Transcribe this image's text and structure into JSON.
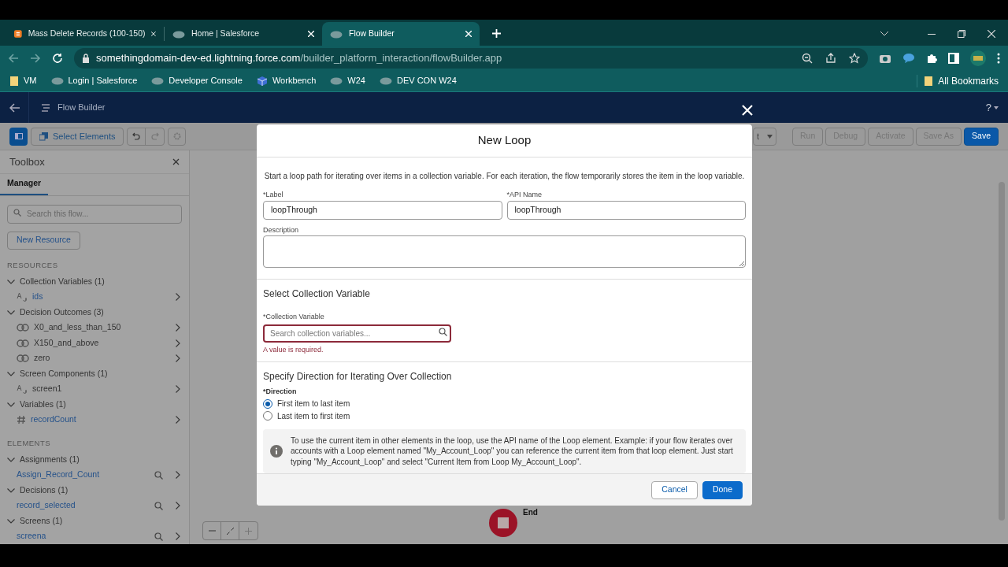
{
  "browser": {
    "tabs": [
      {
        "title": "Mass Delete Records (100-150)",
        "selected": false
      },
      {
        "title": "Home | Salesforce",
        "selected": false
      },
      {
        "title": "Flow Builder",
        "selected": true
      }
    ],
    "url_host": "somethingdomain-dev-ed.lightning.force.com",
    "url_path": "/builder_platform_interaction/flowBuilder.app",
    "bookmarks": [
      {
        "label": "VM"
      },
      {
        "label": "Login | Salesforce"
      },
      {
        "label": "Developer Console"
      },
      {
        "label": "Workbench"
      },
      {
        "label": "W24"
      },
      {
        "label": "DEV CON W24"
      }
    ],
    "all_bookmarks": "All Bookmarks"
  },
  "app_header": {
    "title": "Flow Builder",
    "help": "?"
  },
  "toolbar": {
    "select_elements": "Select Elements",
    "dropdown_visible_text": "t",
    "buttons": [
      {
        "label": "Run",
        "disabled": true
      },
      {
        "label": "Debug",
        "disabled": true
      },
      {
        "label": "Activate",
        "disabled": true
      },
      {
        "label": "Save As",
        "disabled": true
      },
      {
        "label": "Save",
        "disabled": false
      }
    ]
  },
  "toolbox": {
    "title": "Toolbox",
    "tabs": [
      {
        "label": "Manager",
        "selected": true
      }
    ],
    "search_placeholder": "Search this flow...",
    "new_resource": "New Resource",
    "sections": [
      {
        "heading": "RESOURCES",
        "groups": [
          {
            "label": "Collection Variables (1)",
            "expanded": true,
            "children": [
              {
                "label": "ids",
                "kind": "text"
              }
            ]
          },
          {
            "label": "Decision Outcomes (3)",
            "expanded": true,
            "children": [
              {
                "label": "X0_and_less_than_150",
                "kind": "outcome"
              },
              {
                "label": "X150_and_above",
                "kind": "outcome"
              },
              {
                "label": "zero",
                "kind": "outcome"
              }
            ]
          },
          {
            "label": "Screen Components (1)",
            "expanded": true,
            "children": [
              {
                "label": "screen1",
                "kind": "text"
              }
            ]
          },
          {
            "label": "Variables (1)",
            "expanded": true,
            "children": [
              {
                "label": "recordCount",
                "kind": "number"
              }
            ]
          }
        ]
      },
      {
        "heading": "ELEMENTS",
        "groups": [
          {
            "label": "Assignments (1)",
            "expanded": true,
            "children": [
              {
                "label": "Assign_Record_Count",
                "kind": "element"
              }
            ]
          },
          {
            "label": "Decisions (1)",
            "expanded": true,
            "children": [
              {
                "label": "record_selected",
                "kind": "element"
              }
            ]
          },
          {
            "label": "Screens (1)",
            "expanded": true,
            "children": [
              {
                "label": "screena",
                "kind": "element"
              }
            ]
          }
        ]
      }
    ]
  },
  "canvas": {
    "end_label": "End"
  },
  "modal": {
    "title": "New Loop",
    "intro": "Start a loop path for iterating over items in a collection variable. For each iteration, the flow temporarily stores the item in the loop variable.",
    "label_field": {
      "label": "*Label",
      "value": "loopThrough"
    },
    "api_name_field": {
      "label": "*API Name",
      "value": "loopThrough"
    },
    "description_field": {
      "label": "Description"
    },
    "collection_section": "Select Collection Variable",
    "collection_field": {
      "label": "*Collection Variable",
      "placeholder": "Search collection variables...",
      "error": "A value is required."
    },
    "direction_section": "Specify Direction for Iterating Over Collection",
    "direction_label": "*Direction",
    "direction_options": [
      {
        "label": "First item to last item",
        "selected": true
      },
      {
        "label": "Last item to first item",
        "selected": false
      }
    ],
    "info": "To use the current item in other elements in the loop, use the API name of the Loop element. Example: if your flow iterates over accounts with a Loop element named \"My_Account_Loop\" you can reference the current item from that loop element. Just start typing \"My_Account_Loop\" and select \"Current Item from Loop My_Account_Loop\".",
    "buttons": [
      {
        "label": "Cancel",
        "kind": "neutral"
      },
      {
        "label": "Done",
        "kind": "brand"
      }
    ]
  }
}
